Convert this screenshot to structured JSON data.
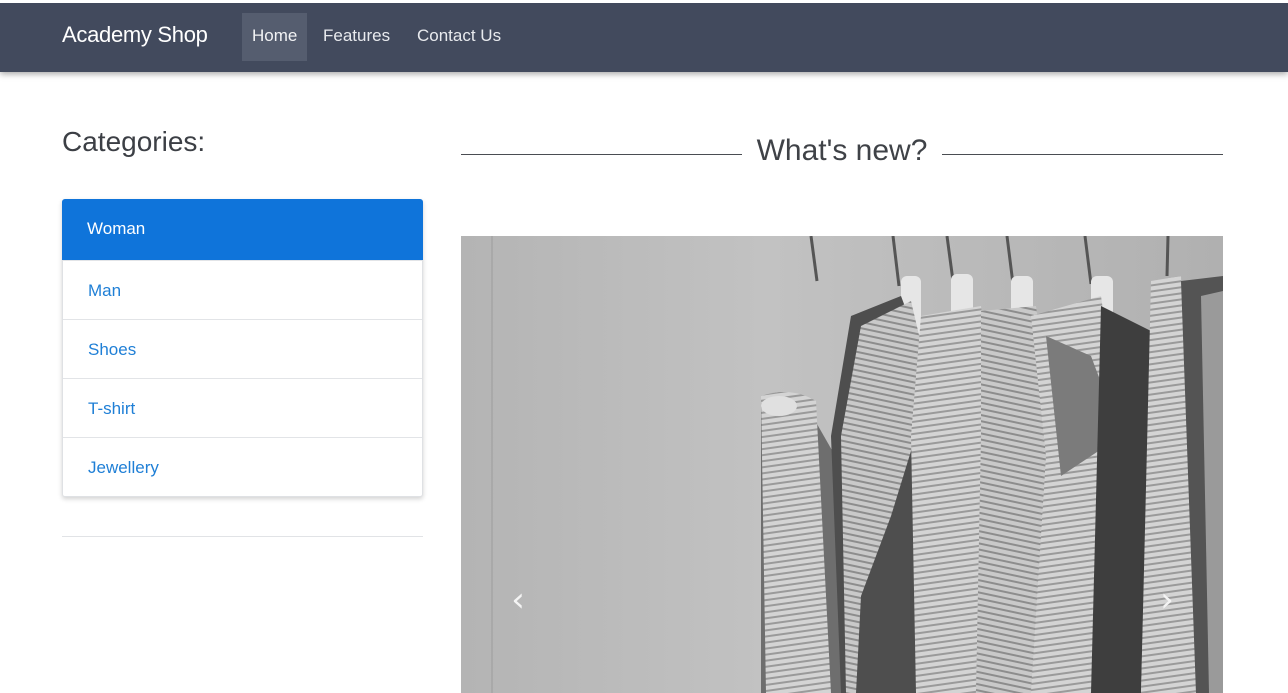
{
  "navbar": {
    "brand": "Academy Shop",
    "links": [
      {
        "label": "Home",
        "active": true
      },
      {
        "label": "Features",
        "active": false
      },
      {
        "label": "Contact Us",
        "active": false
      }
    ],
    "background": "#424a5d"
  },
  "sidebar": {
    "title": "Categories:",
    "items": [
      {
        "label": "Woman",
        "active": true
      },
      {
        "label": "Man",
        "active": false
      },
      {
        "label": "Shoes",
        "active": false
      },
      {
        "label": "T-shirt",
        "active": false
      },
      {
        "label": "Jewellery",
        "active": false
      }
    ],
    "accent": "#0f74da",
    "link_color": "#1f7fd6"
  },
  "main": {
    "section_title": "What's new?",
    "carousel": {
      "slide_description": "grayscale photo of pleated shirts on hangers",
      "prev_icon": "chevron-left-icon",
      "next_icon": "chevron-right-icon"
    }
  }
}
